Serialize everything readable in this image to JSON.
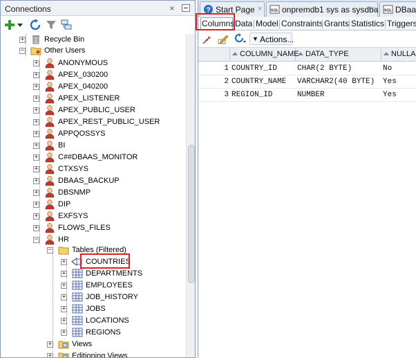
{
  "connections_panel": {
    "title": "Connections",
    "close_glyph": "×",
    "toolbar_icons": [
      "add-connection-icon",
      "chevron-down-icon",
      "refresh-icon",
      "filter-icon",
      "schema-browser-icon"
    ],
    "tree": {
      "recycle_bin": "Recycle Bin",
      "other_users": "Other Users",
      "users": [
        "ANONYMOUS",
        "APEX_030200",
        "APEX_040200",
        "APEX_LISTENER",
        "APEX_PUBLIC_USER",
        "APEX_REST_PUBLIC_USER",
        "APPQOSSYS",
        "BI",
        "C##DBAAS_MONITOR",
        "CTXSYS",
        "DBAAS_BACKUP",
        "DBSNMP",
        "DIP",
        "EXFSYS",
        "FLOWS_FILES",
        "HR"
      ],
      "hr_children": {
        "tables_folder": "Tables (Filtered)",
        "tables": [
          "COUNTRIES",
          "DEPARTMENTS",
          "EMPLOYEES",
          "JOB_HISTORY",
          "JOBS",
          "LOCATIONS",
          "REGIONS"
        ],
        "views": "Views",
        "editioning_views": "Editioning Views"
      }
    }
  },
  "editor": {
    "doc_tabs": [
      {
        "label": "Start Page",
        "icon": "help-icon"
      },
      {
        "label": "onpremdb1 sys as sysdba",
        "icon": "sql-worksheet-icon"
      },
      {
        "label": "DBaa",
        "icon": "sql-worksheet-icon"
      }
    ],
    "close_glyph": "×",
    "object_tabs": [
      "Columns",
      "Data",
      "Model",
      "Constraints",
      "Grants",
      "Statistics",
      "Triggers"
    ],
    "grid_toolbar": {
      "actions_label": "Actions...",
      "actions_arrow": "▼"
    },
    "grid": {
      "columns": [
        "COLUMN_NAME",
        "DATA_TYPE",
        "NULLAB"
      ],
      "rows": [
        {
          "num": "1",
          "column_name": "COUNTRY_ID",
          "data_type": "CHAR(2 BYTE)",
          "nullable": "No"
        },
        {
          "num": "2",
          "column_name": "COUNTRY_NAME",
          "data_type": "VARCHAR2(40 BYTE)",
          "nullable": "Yes"
        },
        {
          "num": "3",
          "column_name": "REGION_ID",
          "data_type": "NUMBER",
          "nullable": "Yes"
        }
      ]
    }
  },
  "colors": {
    "highlight_border": "#e0201b",
    "panel_border": "#8a9cb4",
    "user_icon": "#c0392b"
  }
}
